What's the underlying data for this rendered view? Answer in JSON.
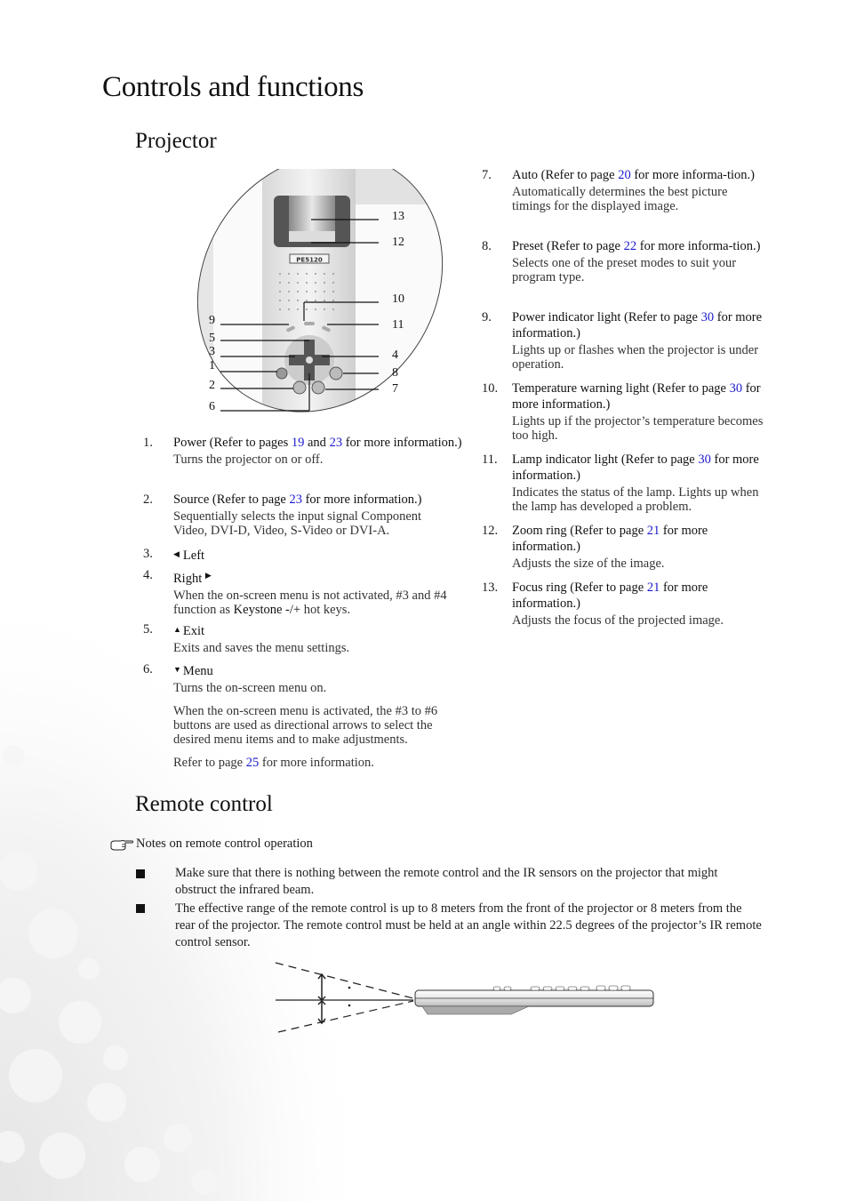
{
  "page_title": "Controls and functions",
  "sections": {
    "projector": "Projector",
    "remote": "Remote control"
  },
  "diagram": {
    "model_label": "PE5120",
    "callouts_left": [
      "9",
      "5",
      "3",
      "1",
      "2",
      "6"
    ],
    "callouts_right": [
      "13",
      "12",
      "10",
      "11",
      "4",
      "8",
      "7"
    ]
  },
  "items_left": [
    {
      "num": "1.",
      "head_pre": "Power (Refer to pages ",
      "link1": "19",
      "mid": " and ",
      "link2": "23",
      "head_post": " for more information.)",
      "desc": "Turns the projector on or off."
    },
    {
      "num": "2.",
      "head_pre": "Source (Refer to page ",
      "link1": "23",
      "head_post": " for more information.)",
      "desc": "Sequentially selects the input signal Component Video, DVI-D, Video, S-Video or DVI-A."
    },
    {
      "num": "3.",
      "icon": "left-arrow-icon",
      "glyph": "◀",
      "head": "Left"
    },
    {
      "num": "4.",
      "head": "Right",
      "icon": "right-arrow-icon",
      "glyph": "▶",
      "desc_pre": "When the on-screen menu is not activated, #3 and #4 function as ",
      "desc_bold": "Keystone -/+",
      "desc_post": " hot keys."
    },
    {
      "num": "5.",
      "icon": "up-arrow-icon",
      "glyph": "▲",
      "head": "Exit",
      "desc": "Exits and saves the menu settings."
    },
    {
      "num": "6.",
      "icon": "down-arrow-icon",
      "glyph": "▼",
      "head": "Menu",
      "desc": "Turns the on-screen menu on.",
      "desc2": "When the on-screen menu is activated, the #3 to #6 buttons are used as directional arrows to select the desired menu items and to make adjustments.",
      "desc3_pre": "Refer to page ",
      "desc3_link": "25",
      "desc3_post": " for more information."
    }
  ],
  "items_right": [
    {
      "num": "7.",
      "head_pre": "Auto (Refer to page ",
      "link1": "20",
      "head_post": " for more informa-tion.)",
      "desc": "Automatically determines the best picture timings for the displayed image."
    },
    {
      "num": "8.",
      "head_pre": "Preset (Refer to page ",
      "link1": "22",
      "head_post": " for more informa-tion.)",
      "desc": "Selects one of the preset modes to suit your program type."
    },
    {
      "num": "9.",
      "head_pre": "Power indicator light  (Refer to page ",
      "link1": "30",
      "head_post": " for more information.)",
      "desc": "Lights up or flashes when the projector is under operation."
    },
    {
      "num": "10.",
      "head_pre": "Temperature warning light (Refer to page ",
      "link1": "30",
      "head_post": " for more information.)",
      "desc": "Lights up if the projector’s temperature becomes too high."
    },
    {
      "num": "11.",
      "head_pre": "Lamp indicator light (Refer to page ",
      "link1": "30",
      "head_post": " for more information.)",
      "desc": "Indicates the status of the lamp. Lights up when the lamp has developed a problem."
    },
    {
      "num": "12.",
      "head_pre": "Zoom ring (Refer to page ",
      "link1": "21",
      "head_post": " for more information.)",
      "desc": "Adjusts the size of the image."
    },
    {
      "num": "13.",
      "head_pre": "Focus ring (Refer to page ",
      "link1": "21",
      "head_post": " for more information.)",
      "desc": "Adjusts the focus of the projected image."
    }
  ],
  "note": {
    "icon": "pointing-hand-icon",
    "heading": "Notes on remote control operation",
    "bullets": [
      "Make sure that there is nothing between the remote control and the IR sensors on the projector that might obstruct the infrared beam.",
      "The effective range of the remote control is up to 8 meters from the front of the projector or 8 meters from the rear of the projector. The remote control must be held at an angle within 22.5 degrees of the projector’s IR remote control sensor."
    ]
  },
  "colors": {
    "link": "#1a1acc",
    "highlight_red": "#e0201a"
  }
}
